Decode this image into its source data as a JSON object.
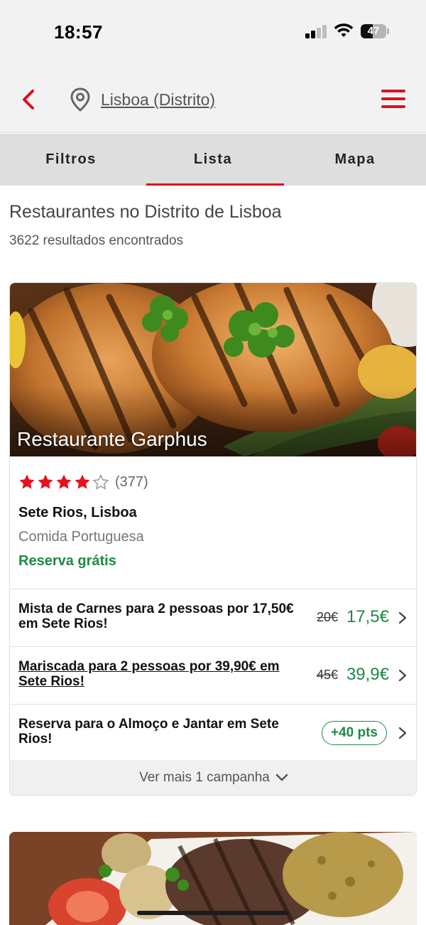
{
  "status_bar": {
    "time": "18:57",
    "battery": "47",
    "battery_level": 0.47
  },
  "header": {
    "location": "Lisboa (Distrito)",
    "back_icon": "chevron-left-icon",
    "location_icon": "map-pin-icon",
    "menu_icon": "hamburger-menu-icon",
    "accent_color": "#d9121f"
  },
  "tabs": [
    {
      "label": "Filtros",
      "active": false
    },
    {
      "label": "Lista",
      "active": true
    },
    {
      "label": "Mapa",
      "active": false
    }
  ],
  "results": {
    "title": "Restaurantes no Distrito de Lisboa",
    "count": "3622 resultados encontrados"
  },
  "restaurant": {
    "name": "Restaurante Garphus",
    "rating_stars": 4,
    "rating_max": 5,
    "rating_count": "(377)",
    "location": "Sete Rios, Lisboa",
    "cuisine": "Comida Portuguesa",
    "reservation": "Reserva grátis",
    "offers": [
      {
        "text": "Mista de Carnes para 2 pessoas por 17,50€ em Sete Rios!",
        "old_price": "20€",
        "new_price": "17,5€"
      },
      {
        "text": "Mariscada para 2 pessoas por 39,90€ em Sete Rios!",
        "old_price": "45€",
        "new_price": "39,9€"
      },
      {
        "text": "Reserva para o Almoço e Jantar em Sete Rios!",
        "points": "+40 pts"
      }
    ],
    "more_campaigns": "Ver mais 1 campanha",
    "price_color": "#1e8a45"
  }
}
